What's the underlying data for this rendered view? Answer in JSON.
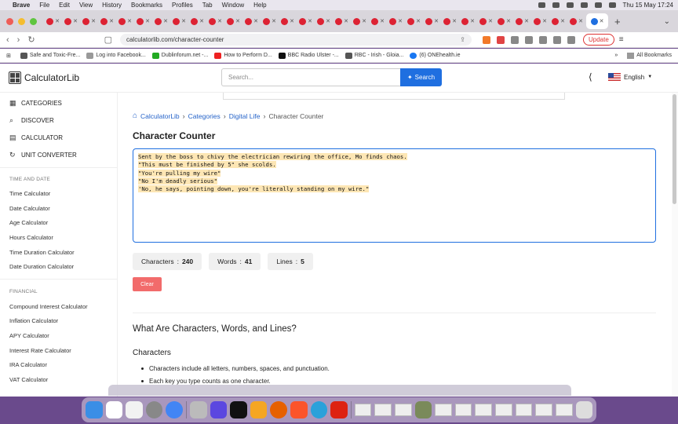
{
  "menubar": {
    "app": "Brave",
    "items": [
      "File",
      "Edit",
      "View",
      "History",
      "Bookmarks",
      "Profiles",
      "Tab",
      "Window",
      "Help"
    ],
    "clock": "Thu 15 May  17:24"
  },
  "address": {
    "url": "calculatorlib.com/character-counter",
    "update_label": "Update"
  },
  "bookmarks": {
    "items": [
      "Safe and Toxic-Fre...",
      "Log into Facebook...",
      "Dublinforum.net -...",
      "How to Perform D...",
      "BBC Radio Ulster -...",
      "RBC - Irish - Gloia...",
      "(6) ONEhealth.ie"
    ],
    "all_label": "All Bookmarks"
  },
  "header": {
    "logo": "CalculatorLib",
    "search_placeholder": "Search...",
    "search_button": "Search",
    "language": "English"
  },
  "sidebar": {
    "nav": [
      "CATEGORIES",
      "DISCOVER",
      "CALCULATOR",
      "UNIT CONVERTER"
    ],
    "time_section": "TIME AND DATE",
    "time_links": [
      "Time Calculator",
      "Date Calculator",
      "Age Calculator",
      "Hours Calculator",
      "Time Duration Calculator",
      "Date Duration Calculator"
    ],
    "financial_section": "FINANCIAL",
    "financial_links": [
      "Compound Interest Calculator",
      "Inflation Calculator",
      "APY Calculator",
      "Interest Rate Calculator",
      "IRA Calculator",
      "VAT Calculator"
    ]
  },
  "breadcrumb": [
    "CalculatorLib",
    "Categories",
    "Digital Life",
    "Character Counter"
  ],
  "page_title": "Character Counter",
  "textarea": {
    "lines": [
      "Sent by the boss to chivy the electrician rewiring the office, Mo finds chaos.",
      "\"This must be finished by 5\" she scolds.",
      "\"You're pulling my wire\"",
      "\"No I'm deadly serious\"",
      "'No, he says, pointing down, you're literally standing on my wire.\""
    ]
  },
  "stats": {
    "characters_label": "Characters",
    "characters_value": "240",
    "words_label": "Words",
    "words_value": "41",
    "lines_label": "Lines",
    "lines_value": "5"
  },
  "clear_label": "Clear",
  "section_title": "What Are Characters, Words, and Lines?",
  "subsection_title": "Characters",
  "bullets": [
    "Characters include all letters, numbers, spaces, and punctuation.",
    "Each key you type counts as one character."
  ],
  "colors": {
    "accent": "#1f6fe0",
    "clear": "#f26b6b",
    "highlight": "#fde6b4"
  }
}
